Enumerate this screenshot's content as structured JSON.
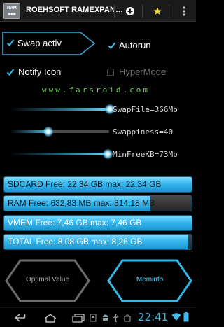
{
  "app": {
    "title": "ROEHSOFT RAMEXPAN…",
    "icon_text": "RAM",
    "icon_name": "ram-chip-icon"
  },
  "actionbar": {
    "add_icon": "plus-circle-icon",
    "star_icon": "star-icon",
    "more_icon": "overflow-menu-icon"
  },
  "controls": {
    "swap": {
      "label": "Swap activ",
      "checked": true
    },
    "autorun": {
      "label": "Autorun",
      "checked": true
    },
    "notify": {
      "label": "Notify Icon",
      "checked": true
    },
    "hypermode": {
      "label": "HyperMode",
      "checked": false,
      "enabled": false
    }
  },
  "watermark": "www.farsroid.com",
  "sliders": [
    {
      "label": "SwapFile=366Mb",
      "level": 0.95
    },
    {
      "label": "Swappiness=40",
      "level": 0.4
    },
    {
      "label": "MinFreeKB=73Mb",
      "level": 0.93
    }
  ],
  "bars": [
    {
      "label": "SDCARD Free: 22,34 GB  max: 22,34 GB",
      "fill": 1.0
    },
    {
      "label": "RAM Free: 632,83 MB  max: 814,18 MB",
      "fill": 0.78
    },
    {
      "label": "VMEM Free: 7,46 GB  max: 7,46 GB",
      "fill": 1.0
    },
    {
      "label": "TOTAL Free: 8,08 GB  max: 8,26 GB",
      "fill": 0.98
    }
  ],
  "buttons": {
    "optimal": "Optimal Value",
    "meminfo": "Meminfo"
  },
  "navbar": {
    "clock": "22:41"
  },
  "colors": {
    "accent": "#33b5e5",
    "green": "#69cc52"
  }
}
